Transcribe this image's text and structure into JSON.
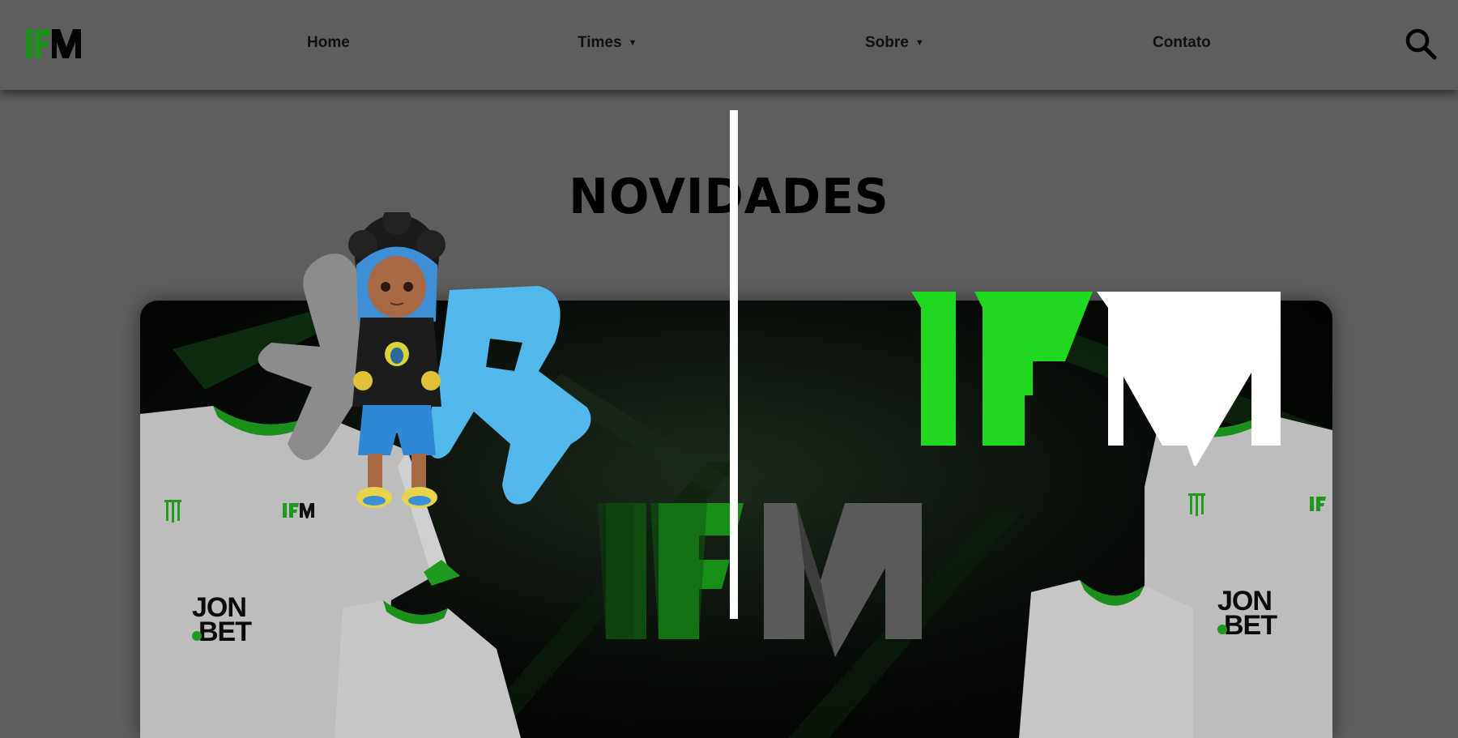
{
  "header": {
    "logo_text": "IFM",
    "nav": [
      {
        "label": "Home",
        "has_dropdown": false
      },
      {
        "label": "Times",
        "has_dropdown": true
      },
      {
        "label": "Sobre",
        "has_dropdown": true
      },
      {
        "label": "Contato",
        "has_dropdown": false
      }
    ],
    "dropdown_glyph": "▼",
    "search_icon": "search-icon"
  },
  "main": {
    "title": "NOVIDADES"
  },
  "banner": {
    "big_logo_text": "IFM",
    "shirt_sponsor": "JON BET",
    "shirt_brand_icon": "monster-claw-icon",
    "mascot_icon": "cartoon-mascot-icon",
    "graffiti_letters": "VR"
  },
  "colors": {
    "page_bg": "#5e5e5e",
    "brand_green": "#1fd81f",
    "dark_green": "#0d5a0d",
    "text": "#111111",
    "graffiti_blue": "#4fb6ea",
    "graffiti_gray": "#8a8a8a"
  }
}
